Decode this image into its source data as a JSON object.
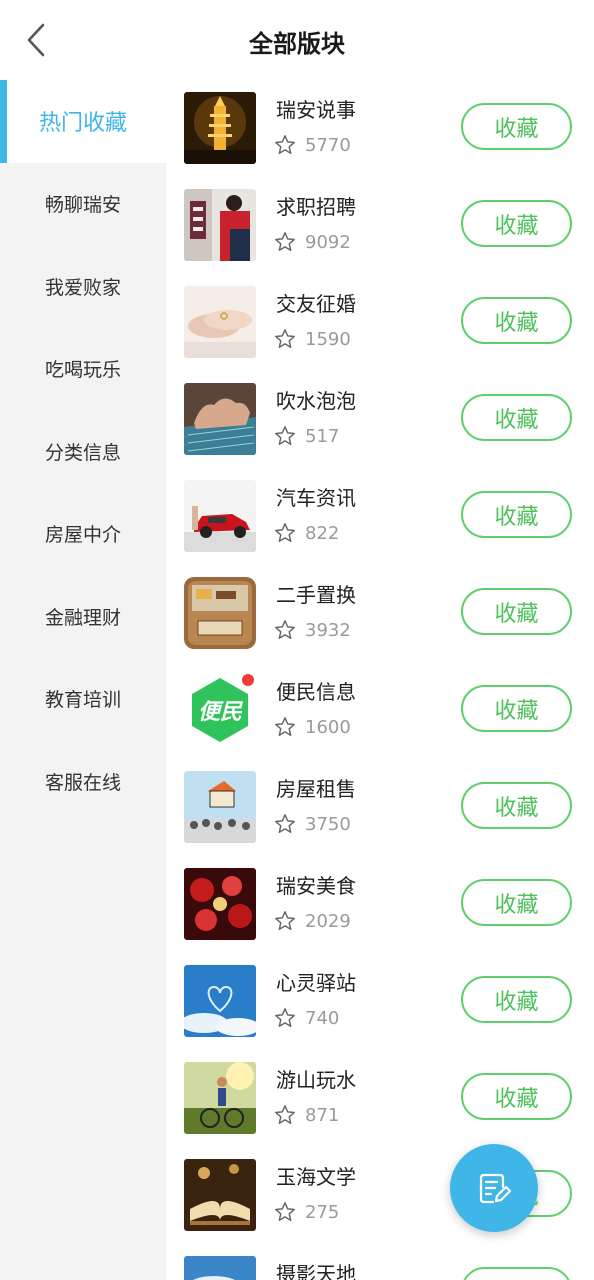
{
  "header": {
    "title": "全部版块"
  },
  "sidebar": {
    "items": [
      {
        "label": "热门收藏",
        "active": true
      },
      {
        "label": "畅聊瑞安"
      },
      {
        "label": "我爱败家"
      },
      {
        "label": "吃喝玩乐"
      },
      {
        "label": "分类信息"
      },
      {
        "label": "房屋中介"
      },
      {
        "label": "金融理财"
      },
      {
        "label": "教育培训"
      },
      {
        "label": "客服在线"
      }
    ]
  },
  "forums": [
    {
      "name": "瑞安说事",
      "count": "5770",
      "button": "收藏",
      "thumb": "pagoda-night-image"
    },
    {
      "name": "求职招聘",
      "count": "9092",
      "button": "收藏",
      "thumb": "recruitment-image"
    },
    {
      "name": "交友征婚",
      "count": "1590",
      "button": "收藏",
      "thumb": "hands-image"
    },
    {
      "name": "吹水泡泡",
      "count": "517",
      "button": "收藏",
      "thumb": "typing-keyboard-image"
    },
    {
      "name": "汽车资讯",
      "count": "822",
      "button": "收藏",
      "thumb": "red-car-image"
    },
    {
      "name": "二手置换",
      "count": "3932",
      "button": "收藏",
      "thumb": "secondhand-box-image"
    },
    {
      "name": "便民信息",
      "count": "1600",
      "button": "收藏",
      "thumb": "bianmin-logo",
      "logo_text": "便民",
      "badge": true
    },
    {
      "name": "房屋租售",
      "count": "3750",
      "button": "收藏",
      "thumb": "house-balloon-image"
    },
    {
      "name": "瑞安美食",
      "count": "2029",
      "button": "收藏",
      "thumb": "food-image"
    },
    {
      "name": "心灵驿站",
      "count": "740",
      "button": "收藏",
      "thumb": "sky-heart-image"
    },
    {
      "name": "游山玩水",
      "count": "871",
      "button": "收藏",
      "thumb": "cyclist-image"
    },
    {
      "name": "玉海文学",
      "count": "275",
      "button": "收藏",
      "thumb": "open-book-image"
    },
    {
      "name": "摄影天地",
      "count": "",
      "button": "收藏",
      "thumb": "landscape-image"
    }
  ],
  "colors": {
    "accent": "#3fb5e8",
    "button_green": "#4cc25a",
    "sidebar_bg": "#f3f3f3"
  },
  "icons": {
    "back": "chevron-left-icon",
    "star": "star-outline-icon",
    "fab": "edit-note-icon"
  }
}
